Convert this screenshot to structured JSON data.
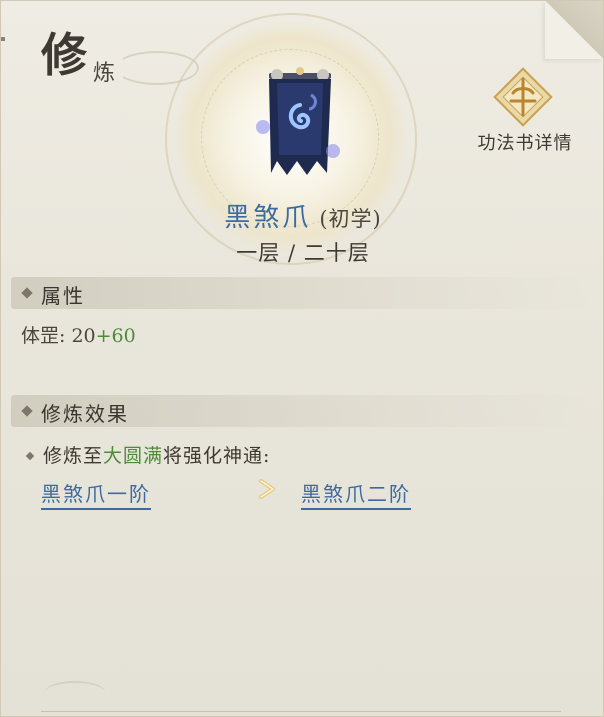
{
  "header": {
    "title_main": "修",
    "title_sub": "炼"
  },
  "skill": {
    "icon": "dark-banner-icon",
    "name": "黑煞爪",
    "rank_tag": "(初学)",
    "level_text": "一层 / 二十层"
  },
  "detail_button": {
    "icon": "golden-emblem-icon",
    "label": "功法书详情"
  },
  "attributes": {
    "heading": "属性",
    "stat_label": "体罡:",
    "base_value": "20",
    "bonus_value": "+60"
  },
  "effects": {
    "heading": "修炼效果",
    "line_prefix": "修炼至",
    "line_highlight": "大圆满",
    "line_suffix": "将强化神通:",
    "from_skill": "黑煞爪一阶",
    "arrow_icon": "chevron-right-icon",
    "to_skill": "黑煞爪二阶"
  },
  "colors": {
    "skill_blue": "#3d6aa0",
    "bonus_green": "#4e8a3a",
    "text_dark": "#3e3a33",
    "parchment": "#ece9e0"
  }
}
